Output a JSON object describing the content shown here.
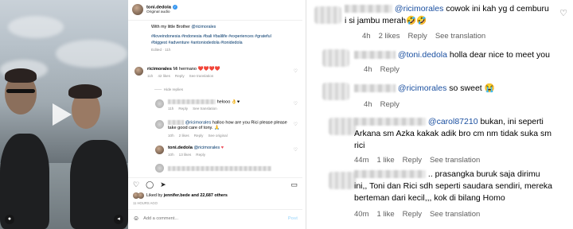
{
  "post": {
    "author": "toni.dedola",
    "audio": "Original audio",
    "caption_head": "With my little Brother",
    "caption_mention": "@ricimorales",
    "hashtags_line1": "#iloveindonesia #indonesia #bali #balilife #experiences #grateful",
    "hashtags_line2": "#biggest #adventure #antoniodedola #tonidedola",
    "caption_meta": "Edited · 11h",
    "liked_by_prefix": "Liked by",
    "liked_by_user": "jennifer.bede",
    "liked_by_suffix": "and 22,687 others",
    "time_ago": "11 HOURS AGO",
    "comment_placeholder": "Add a comment...",
    "post_button": "Post",
    "accent": "#3897f0"
  },
  "comments_small": [
    {
      "user": "ricimorales",
      "text": "Mi hermano ❤️❤️❤️❤️",
      "meta": [
        "11h",
        "42 likes",
        "Reply",
        "See translation"
      ]
    },
    {
      "hide_replies": "Hide replies"
    },
    {
      "text": "helooo 👌♥",
      "meta": [
        "11h",
        "Reply",
        "See translation"
      ]
    },
    {
      "mention": "@ricimorales",
      "text": "halloo how are you Rici please please take good care of tony. 🙏",
      "meta": [
        "10h",
        "2 likes",
        "Reply",
        "See original"
      ]
    },
    {
      "user": "toni.dedola",
      "mention": "@ricimorales",
      "text": "♥",
      "meta": [
        "10h",
        "13 likes",
        "Reply"
      ]
    }
  ],
  "comments_large": [
    {
      "mention": "@ricimorales",
      "text_line1": "cowok ini kah yg d cemburu",
      "text_line2": "i si jambu merah🤣🤣",
      "meta": [
        "4h",
        "2 likes",
        "Reply",
        "See translation"
      ]
    },
    {
      "mention": "@toni.dedola",
      "text_line1": "holla dear nice to meet you",
      "meta": [
        "4h",
        "Reply"
      ]
    },
    {
      "mention": "@ricimorales",
      "text_line1": "so sweet 😭",
      "meta": [
        "4h",
        "Reply"
      ]
    },
    {
      "mention": "@carol87210",
      "text_line1": "bukan, ini seperti",
      "text_line2": "Arkana sm Azka kakak adik bro cm nm tidak suka sm",
      "text_line3": "rici",
      "meta": [
        "44m",
        "1 like",
        "Reply",
        "See translation"
      ]
    },
    {
      "text_line1": ".. prasangka buruk saja dirimu",
      "text_line2": "ini,, Toni dan Rici sdh seperti saudara sendiri, mereka",
      "text_line3": "berteman dari kecil,,, kok di bilang Homo",
      "meta": [
        "40m",
        "1 like",
        "Reply",
        "See translation"
      ]
    }
  ],
  "icons": [
    "play-icon",
    "verified-icon",
    "heart-icon",
    "comment-icon",
    "share-icon",
    "bookmark-icon",
    "emoji-icon",
    "more-icon"
  ]
}
